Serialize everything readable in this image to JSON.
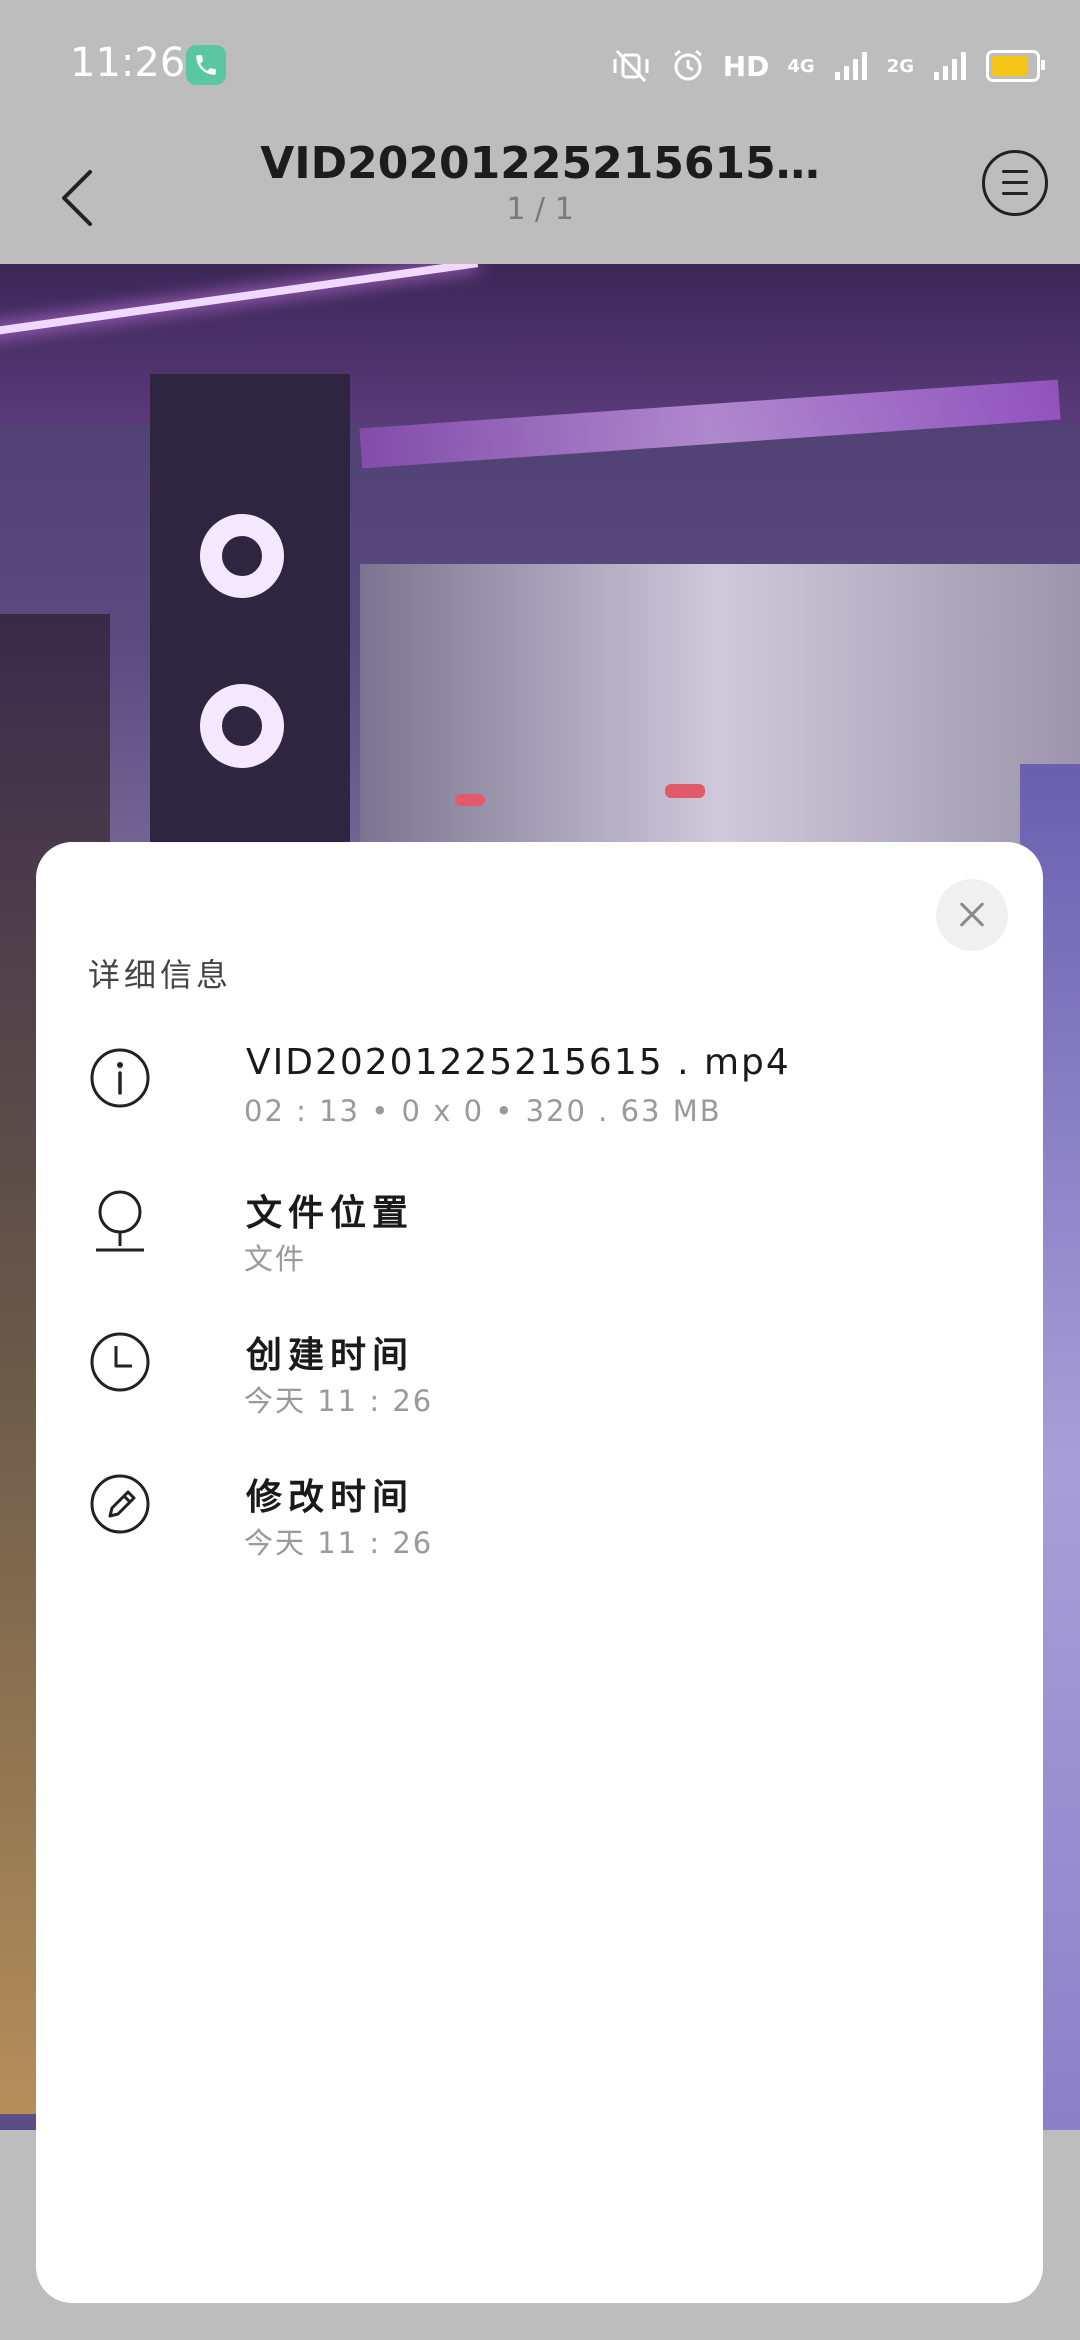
{
  "status_bar": {
    "time": "11:26",
    "network_hd": "HD",
    "network_4g": "4G",
    "network_2g": "2G",
    "battery_color": "#f5c518",
    "icons": [
      "call-icon",
      "vibrate-off-icon",
      "alarm-icon",
      "signal-icon",
      "battery-icon"
    ]
  },
  "header": {
    "title": "VID20201225215615…",
    "counter": "1 / 1"
  },
  "details": {
    "heading": "详细信息",
    "file": {
      "name": "VID20201225215615 . mp4",
      "meta": "02 : 13  •  0 x 0  •  320 . 63 MB"
    },
    "location": {
      "label": "文件位置",
      "value": "文件"
    },
    "created": {
      "label": "创建时间",
      "value": "今天 11 : 26"
    },
    "modified": {
      "label": "修改时间",
      "value": "今天 11 : 26"
    }
  }
}
